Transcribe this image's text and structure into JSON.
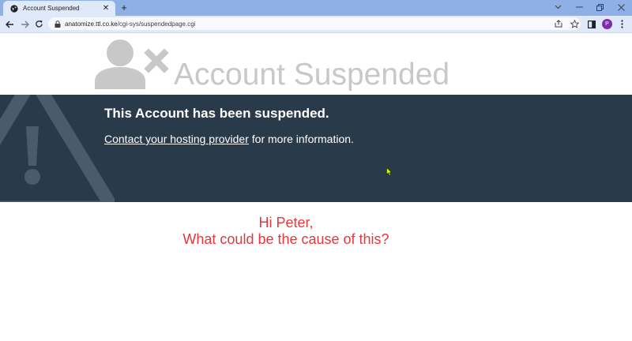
{
  "browser": {
    "tab": {
      "title": "Account Suspended",
      "favicon": "globe-icon"
    },
    "new_tab_icon": "plus-icon",
    "window_controls": [
      "chevron-down-icon",
      "minimize-icon",
      "restore-icon",
      "close-icon"
    ],
    "address": {
      "host": "anatomize.ttl.co.ke",
      "path": "/cgi-sys/suspendedpage.cgi"
    },
    "profile_initial": "P",
    "colors": {
      "titlebar": "#8fb0e6",
      "toolbar": "#dfe9fa",
      "profile": "#7b2fa6"
    }
  },
  "page": {
    "title": "Account Suspended",
    "banner": {
      "heading": "This Account has been suspended.",
      "link_text": "Contact your hosting provider",
      "rest_text": " for more information."
    },
    "message": {
      "line1": "Hi Peter,",
      "line2": "What could be the cause of this?"
    },
    "colors": {
      "banner": "#293a4a",
      "title": "#c8c8c8",
      "message": "#e8363a"
    }
  }
}
